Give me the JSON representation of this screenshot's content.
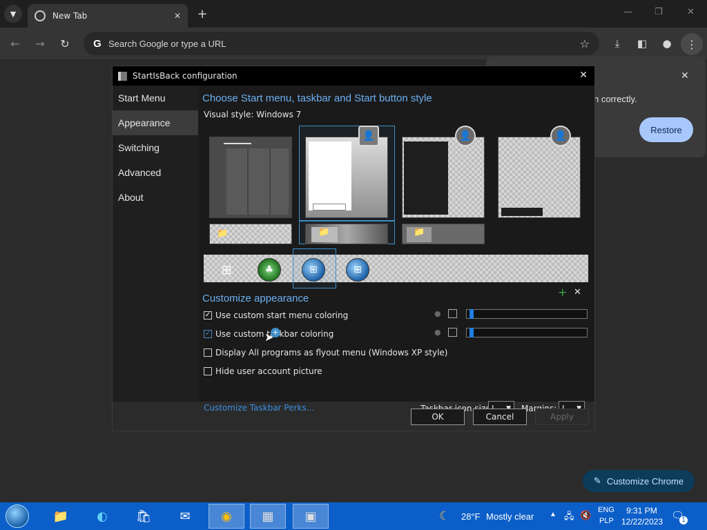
{
  "browser": {
    "tab_title": "New Tab",
    "omnibox_placeholder": "Search Google or type a URL",
    "restore_text": "n correctly.",
    "restore_label": "Restore",
    "customize_label": "Customize Chrome"
  },
  "dialog": {
    "title": "StartIsBack configuration",
    "sidebar": [
      "Start Menu",
      "Appearance",
      "Switching",
      "Advanced",
      "About"
    ],
    "active_item": "Appearance",
    "style_heading": "Choose Start menu, taskbar and Start button style",
    "visual_style": "Visual style:  Windows 7",
    "customize_heading": "Customize appearance",
    "options": [
      {
        "label": "Use custom start menu coloring",
        "checked": true
      },
      {
        "label": "Use custom taskbar coloring",
        "checked": true
      },
      {
        "label": "Display All programs as flyout menu (Windows XP style)",
        "checked": false
      },
      {
        "label": "Hide user account picture",
        "checked": false
      }
    ],
    "perks_link": "Customize Taskbar Perks...",
    "icon_size_label": "Taskbar icon size:",
    "icon_size_value": "L",
    "margins_label": "Margins:",
    "margins_value": "L",
    "buttons": {
      "ok": "OK",
      "cancel": "Cancel",
      "apply": "Apply"
    }
  },
  "taskbar": {
    "weather_temp": "28°F",
    "weather_desc": "Mostly clear",
    "lang_top": "ENG",
    "lang_bottom": "PLP",
    "time": "9:31 PM",
    "date": "12/22/2023",
    "notif_count": "1"
  },
  "colors": {
    "accent": "#6cb0f2",
    "taskbar": "#0c5fc8",
    "restore_button": "#a8c7fa"
  }
}
